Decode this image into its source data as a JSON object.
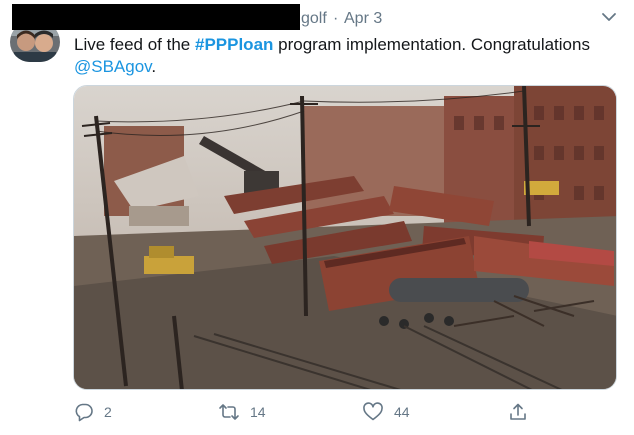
{
  "tweet": {
    "handle_tail": "golf",
    "separator": "·",
    "timestamp": "Apr 3",
    "text_before": "Live feed of the ",
    "hashtag": "#PPPloan",
    "text_after": " program implementation.  Congratulations ",
    "mention": "@SBAgov",
    "text_end": "."
  },
  "actions": {
    "reply_count": "2",
    "retweet_count": "14",
    "like_count": "44"
  },
  "colors": {
    "link": "#1b95e0",
    "muted": "#657786",
    "text": "#14171a"
  },
  "icons": [
    "chevron-down-icon",
    "reply-icon",
    "retweet-icon",
    "like-icon",
    "share-icon"
  ]
}
